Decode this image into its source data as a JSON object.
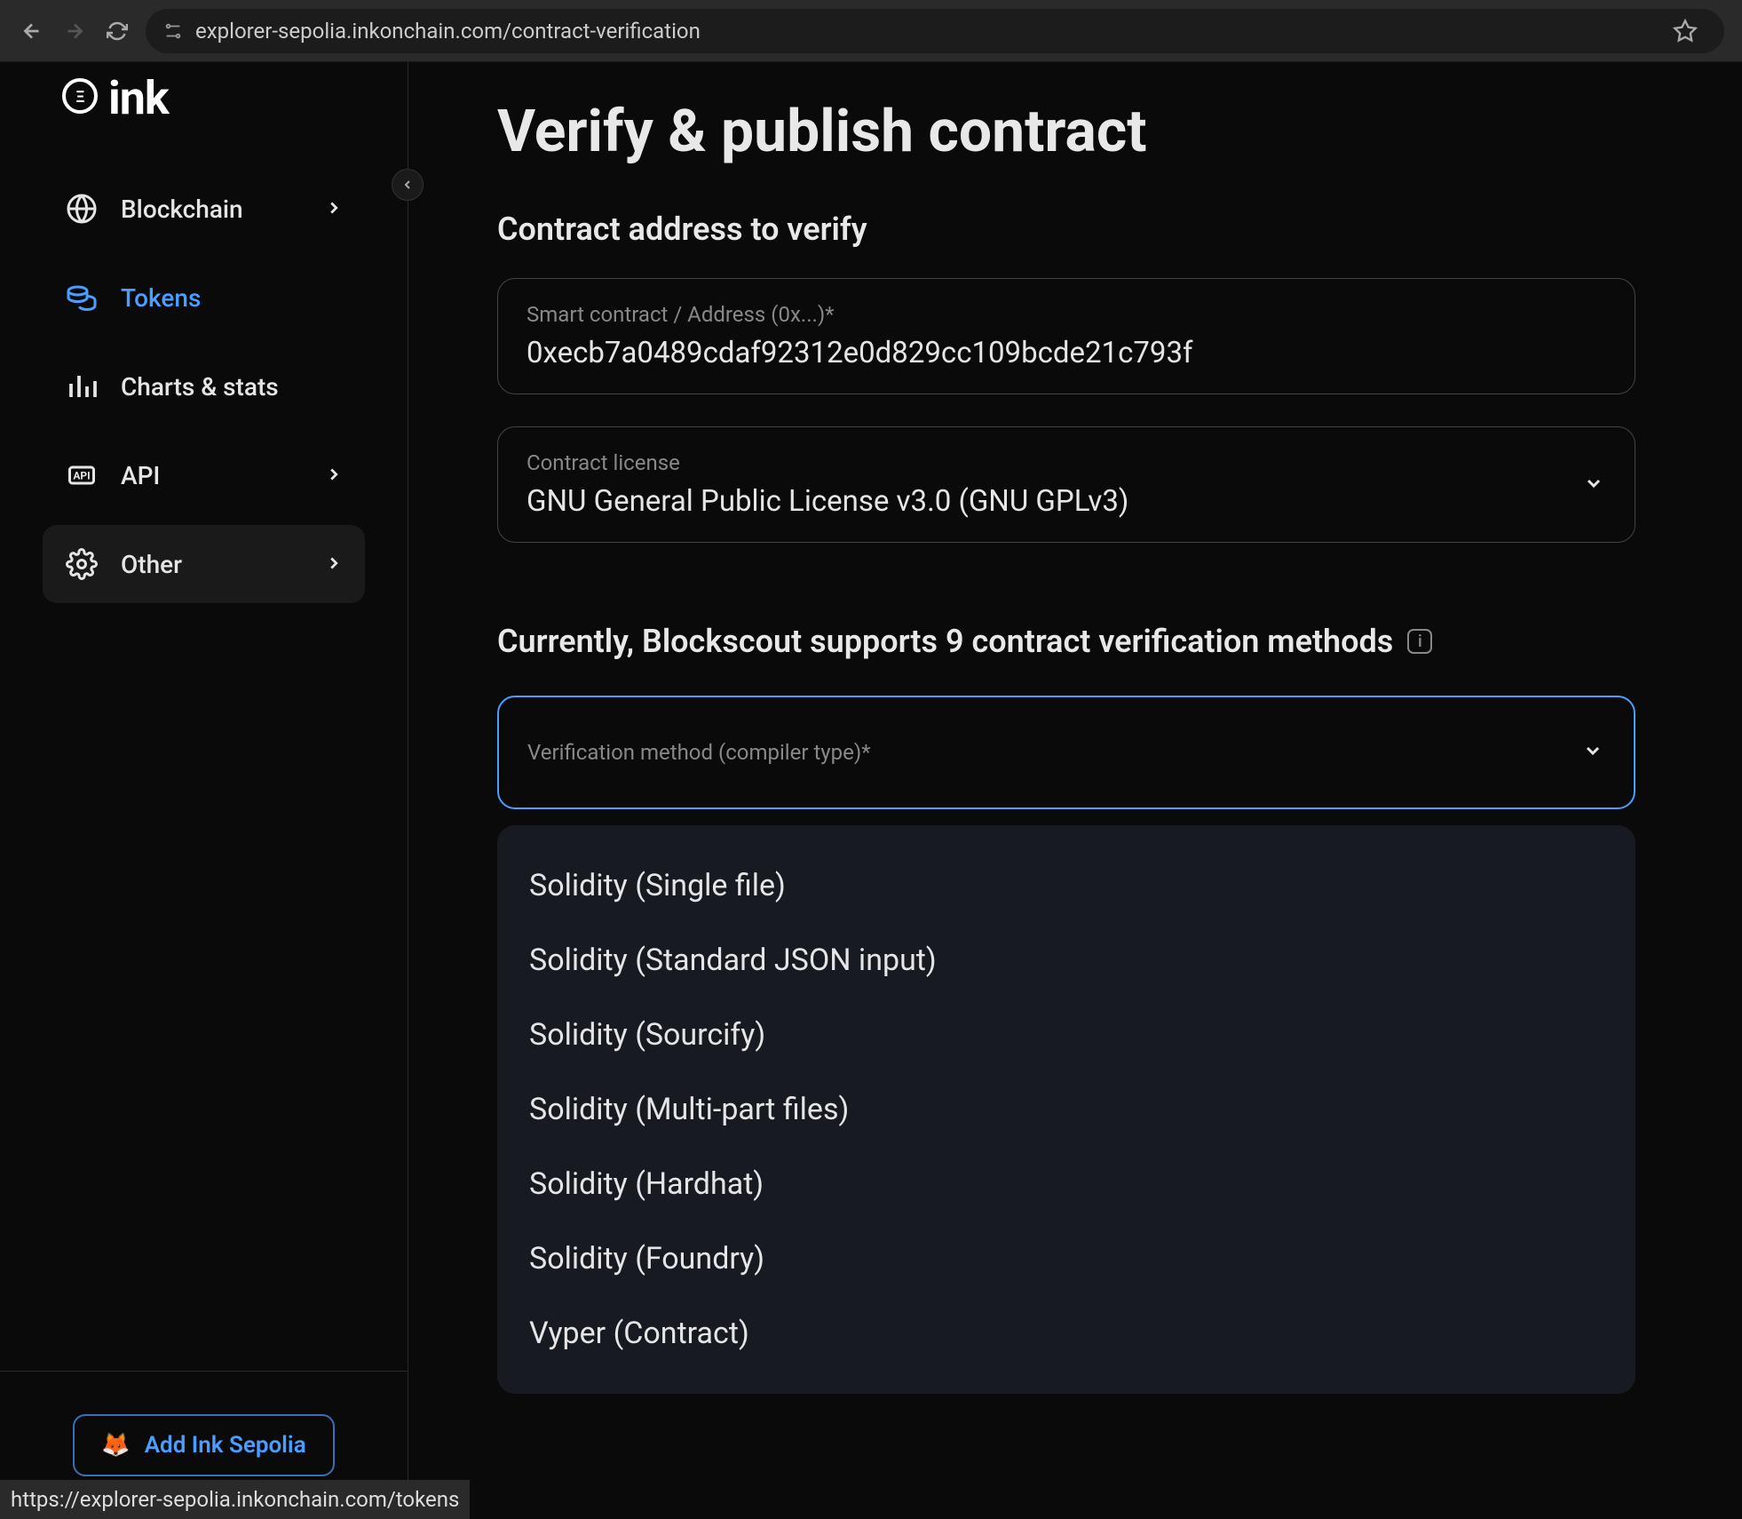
{
  "browser": {
    "url": "explorer-sepolia.inkonchain.com/contract-verification",
    "status_url": "https://explorer-sepolia.inkonchain.com/tokens"
  },
  "brand": {
    "name": "ink"
  },
  "sidebar": {
    "items": [
      {
        "label": "Blockchain",
        "icon": "globe-icon",
        "has_chevron": true
      },
      {
        "label": "Tokens",
        "icon": "coins-icon",
        "active": true
      },
      {
        "label": "Charts & stats",
        "icon": "chart-icon"
      },
      {
        "label": "API",
        "icon": "api-icon",
        "has_chevron": true
      },
      {
        "label": "Other",
        "icon": "gear-icon",
        "has_chevron": true,
        "selected": true
      }
    ],
    "add_network": "Add Ink Sepolia"
  },
  "page": {
    "title": "Verify & publish contract",
    "section_address": "Contract address to verify",
    "address_label": "Smart contract / Address (0x...)*",
    "address_value": "0xecb7a0489cdaf92312e0d829cc109bcde21c793f",
    "license_label": "Contract license",
    "license_value": "GNU General Public License v3.0 (GNU GPLv3)",
    "methods_title": "Currently, Blockscout supports 9 contract verification methods",
    "method_label": "Verification method (compiler type)*",
    "methods": [
      "Solidity (Single file)",
      "Solidity (Standard JSON input)",
      "Solidity (Sourcify)",
      "Solidity (Multi-part files)",
      "Solidity (Hardhat)",
      "Solidity (Foundry)",
      "Vyper (Contract)"
    ]
  },
  "colors": {
    "accent": "#4a9eff",
    "bg": "#0a0a0a",
    "panel": "#171b21",
    "border": "#444"
  }
}
